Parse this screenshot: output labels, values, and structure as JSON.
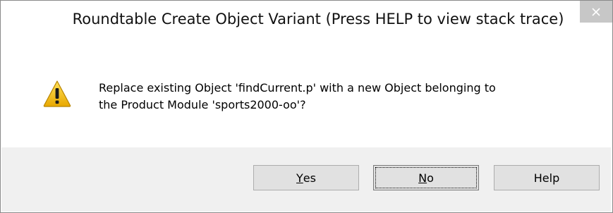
{
  "window": {
    "title": "Roundtable Create Object Variant (Press HELP to view stack trace)"
  },
  "icons": {
    "close": "close-icon",
    "warning": "warning-icon"
  },
  "message": {
    "text": "Replace existing Object 'findCurrent.p' with a new Object belonging to\nthe Product Module 'sports2000-oo'?"
  },
  "buttons": {
    "yes": {
      "mnemonic": "Y",
      "rest": "es"
    },
    "no": {
      "mnemonic": "N",
      "rest": "o"
    },
    "help": {
      "label": "Help"
    }
  },
  "colors": {
    "footer_bg": "#f0f0f0",
    "close_bg": "#c7c7c7",
    "warning_yellow": "#f2c200"
  }
}
